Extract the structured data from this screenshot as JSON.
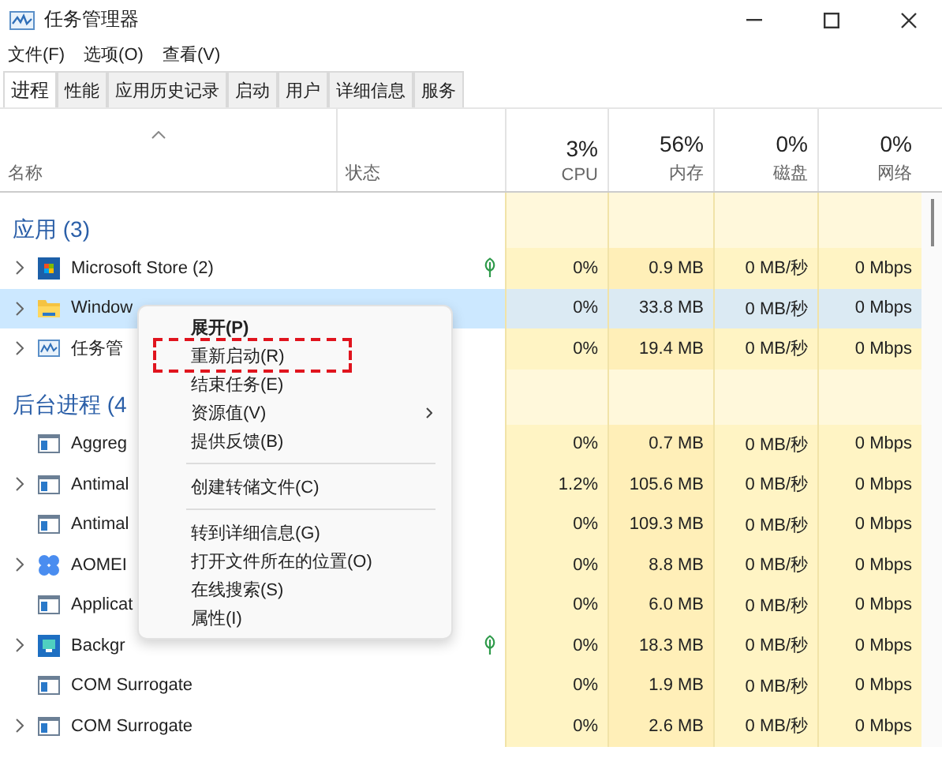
{
  "window": {
    "title": "任务管理器"
  },
  "menu_bar": [
    "文件(F)",
    "选项(O)",
    "查看(V)"
  ],
  "tabs": [
    {
      "label": "进程",
      "selected": true
    },
    {
      "label": "性能",
      "selected": false
    },
    {
      "label": "应用历史记录",
      "selected": false
    },
    {
      "label": "启动",
      "selected": false
    },
    {
      "label": "用户",
      "selected": false
    },
    {
      "label": "详细信息",
      "selected": false
    },
    {
      "label": "服务",
      "selected": false
    }
  ],
  "columns": {
    "name": "名称",
    "status": "状态",
    "metrics": [
      {
        "percent": "3%",
        "label": "CPU"
      },
      {
        "percent": "56%",
        "label": "内存"
      },
      {
        "percent": "0%",
        "label": "磁盘"
      },
      {
        "percent": "0%",
        "label": "网络"
      }
    ]
  },
  "rows": [
    {
      "kind": "group",
      "label": "应用 (3)"
    },
    {
      "kind": "process",
      "name": "Microsoft Store (2)",
      "expandable": true,
      "selected": false,
      "eco": true,
      "values": [
        "0%",
        "0.9 MB",
        "0 MB/秒",
        "0 Mbps"
      ]
    },
    {
      "kind": "process",
      "name": "Window",
      "expandable": true,
      "selected": true,
      "eco": false,
      "values": [
        "0%",
        "33.8 MB",
        "0 MB/秒",
        "0 Mbps"
      ]
    },
    {
      "kind": "process",
      "name": "任务管",
      "expandable": true,
      "selected": false,
      "eco": false,
      "values": [
        "0%",
        "19.4 MB",
        "0 MB/秒",
        "0 Mbps"
      ]
    },
    {
      "kind": "group",
      "label": "后台进程 (4"
    },
    {
      "kind": "process",
      "name": "Aggreg",
      "expandable": false,
      "selected": false,
      "eco": false,
      "values": [
        "0%",
        "0.7 MB",
        "0 MB/秒",
        "0 Mbps"
      ]
    },
    {
      "kind": "process",
      "name": "Antimal",
      "expandable": true,
      "selected": false,
      "eco": false,
      "values": [
        "1.2%",
        "105.6 MB",
        "0 MB/秒",
        "0 Mbps"
      ]
    },
    {
      "kind": "process",
      "name": "Antimal",
      "expandable": false,
      "selected": false,
      "eco": false,
      "values": [
        "0%",
        "109.3 MB",
        "0 MB/秒",
        "0 Mbps"
      ]
    },
    {
      "kind": "process",
      "name": "AOMEI",
      "expandable": true,
      "selected": false,
      "eco": false,
      "values": [
        "0%",
        "8.8 MB",
        "0 MB/秒",
        "0 Mbps"
      ]
    },
    {
      "kind": "process",
      "name": "Applicat",
      "expandable": false,
      "selected": false,
      "eco": false,
      "values": [
        "0%",
        "6.0 MB",
        "0 MB/秒",
        "0 Mbps"
      ]
    },
    {
      "kind": "process",
      "name": "Backgr",
      "expandable": true,
      "selected": false,
      "eco": true,
      "values": [
        "0%",
        "18.3 MB",
        "0 MB/秒",
        "0 Mbps"
      ]
    },
    {
      "kind": "process",
      "name": "COM Surrogate",
      "expandable": false,
      "selected": false,
      "eco": false,
      "values": [
        "0%",
        "1.9 MB",
        "0 MB/秒",
        "0 Mbps"
      ]
    },
    {
      "kind": "process",
      "name": "COM Surrogate",
      "expandable": true,
      "selected": false,
      "eco": false,
      "values": [
        "0%",
        "2.6 MB",
        "0 MB/秒",
        "0 Mbps"
      ]
    }
  ],
  "context_menu": {
    "groups": [
      [
        {
          "label": "展开(P)",
          "bold": true,
          "submenu": false,
          "annotated": false
        },
        {
          "label": "重新启动(R)",
          "bold": false,
          "submenu": false,
          "annotated": true
        },
        {
          "label": "结束任务(E)",
          "bold": false,
          "submenu": false,
          "annotated": false
        },
        {
          "label": "资源值(V)",
          "bold": false,
          "submenu": true,
          "annotated": false
        },
        {
          "label": "提供反馈(B)",
          "bold": false,
          "submenu": false,
          "annotated": false
        }
      ],
      [
        {
          "label": "创建转储文件(C)",
          "bold": false,
          "submenu": false,
          "annotated": false
        }
      ],
      [
        {
          "label": "转到详细信息(G)",
          "bold": false,
          "submenu": false,
          "annotated": false
        },
        {
          "label": "打开文件所在的位置(O)",
          "bold": false,
          "submenu": false,
          "annotated": false
        },
        {
          "label": "在线搜索(S)",
          "bold": false,
          "submenu": false,
          "annotated": false
        },
        {
          "label": "属性(I)",
          "bold": false,
          "submenu": false,
          "annotated": false
        }
      ]
    ]
  }
}
